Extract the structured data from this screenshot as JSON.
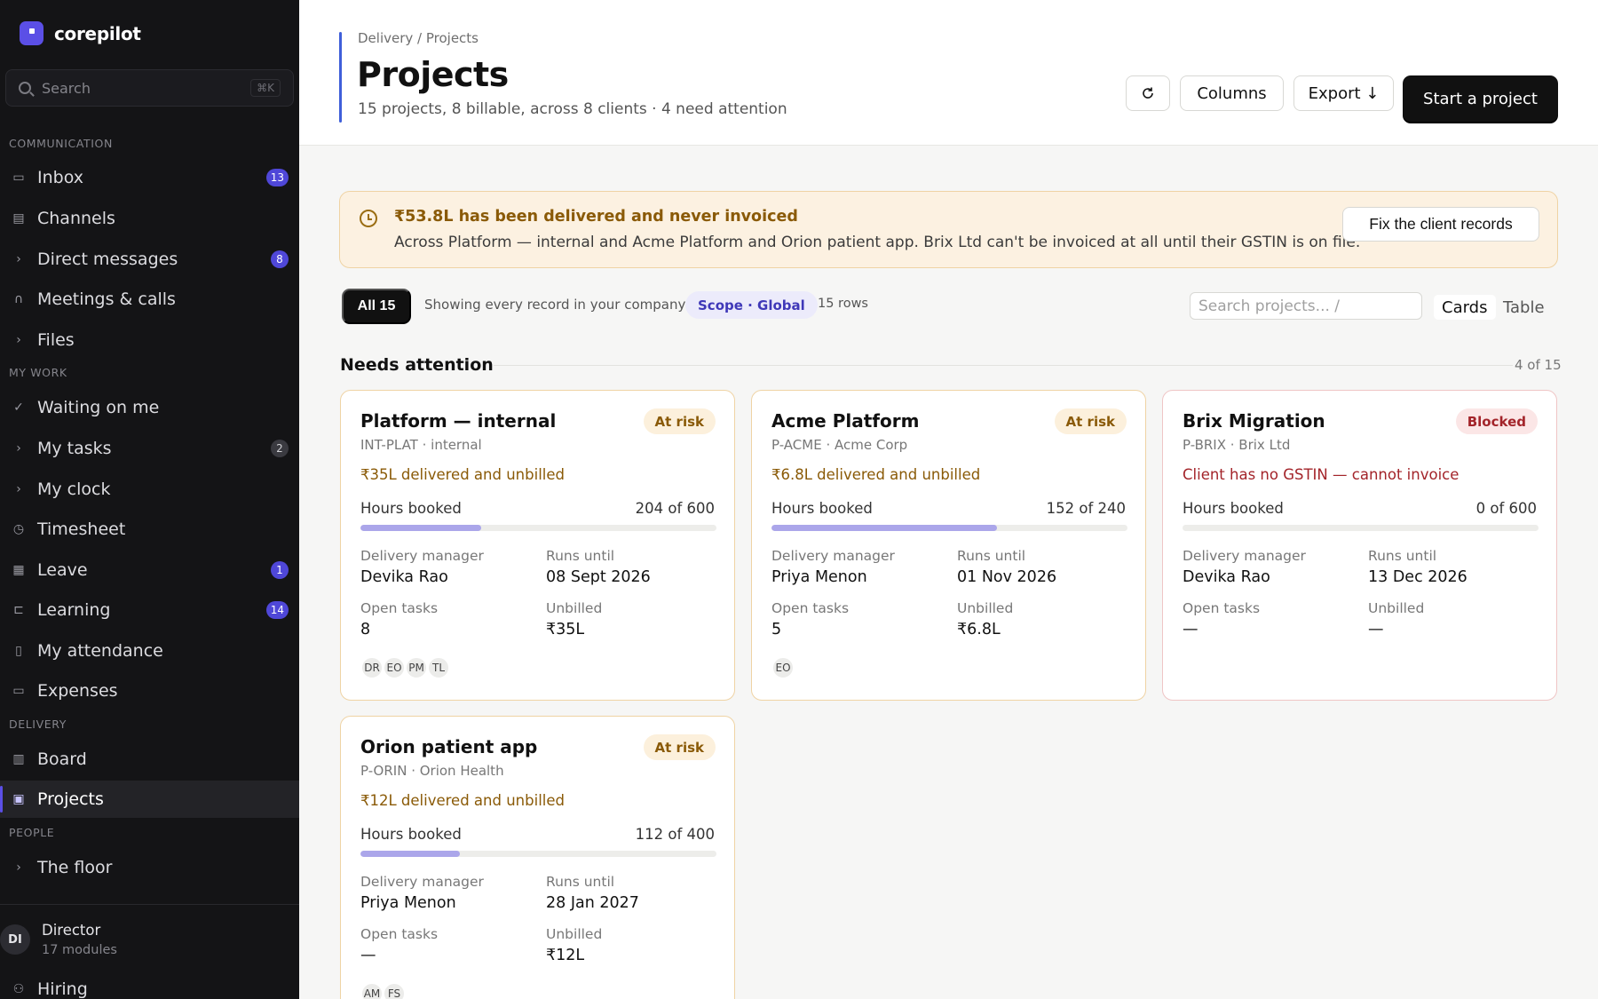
{
  "app": {
    "name": "corepilot"
  },
  "search": {
    "placeholder": "Search",
    "shortcut": "⌘K"
  },
  "sidebar": {
    "sections": {
      "communication": "COMMUNICATION",
      "my_work": "MY WORK",
      "delivery": "DELIVERY",
      "people": "PEOPLE"
    },
    "items": {
      "inbox": {
        "label": "Inbox",
        "badge": "13",
        "icon": "inbox-icon"
      },
      "channels": {
        "label": "Channels",
        "icon": "chat-icon"
      },
      "direct_messages": {
        "label": "Direct messages",
        "badge": "8",
        "icon": "chevron-right-icon"
      },
      "meetings": {
        "label": "Meetings & calls",
        "icon": "headset-icon"
      },
      "files": {
        "label": "Files",
        "icon": "chevron-right-icon"
      },
      "waiting": {
        "label": "Waiting on me",
        "icon": "check-icon"
      },
      "my_tasks": {
        "label": "My tasks",
        "badge": "2",
        "icon": "chevron-right-icon"
      },
      "my_clock": {
        "label": "My clock",
        "icon": "chevron-right-icon"
      },
      "timesheet": {
        "label": "Timesheet",
        "icon": "clock-icon"
      },
      "leave": {
        "label": "Leave",
        "badge": "1",
        "icon": "calendar-icon"
      },
      "learning": {
        "label": "Learning",
        "badge": "14",
        "icon": "easel-icon"
      },
      "attendance": {
        "label": "My attendance",
        "icon": "phone-icon"
      },
      "expenses": {
        "label": "Expenses",
        "icon": "card-icon"
      },
      "board": {
        "label": "Board",
        "icon": "kanban-icon"
      },
      "projects": {
        "label": "Projects",
        "icon": "briefcase-icon"
      },
      "the_floor": {
        "label": "The floor",
        "icon": "chevron-right-icon"
      },
      "hiring": {
        "label": "Hiring",
        "icon": "user-add-icon"
      }
    },
    "user": {
      "initials": "DI",
      "name": "Director",
      "subtitle": "17 modules"
    }
  },
  "header": {
    "breadcrumb": "Delivery / Projects",
    "title": "Projects",
    "subtitle": "15 projects, 8 billable, across 8 clients · 4 need attention",
    "refresh_icon": "refresh-icon",
    "columns_label": "Columns",
    "export_label": "Export ↓",
    "start_label": "Start a project"
  },
  "alert": {
    "icon": "clock-icon",
    "title": "₹53.8L has been delivered and never invoiced",
    "text": "Across Platform — internal and Acme Platform and Orion patient app. Brix Ltd can't be invoiced at all until their GSTIN is on file.",
    "button": "Fix the client records"
  },
  "filters": {
    "all_label": "All 15",
    "showing_text": "Showing every record in your company",
    "scope": "Scope · Global",
    "rows": "15 rows",
    "search_placeholder": "Search projects...  /",
    "view_cards": "Cards",
    "view_table": "Table"
  },
  "section": {
    "title": "Needs attention",
    "count": "4 of 15"
  },
  "labels": {
    "hours_booked": "Hours booked",
    "delivery_manager": "Delivery manager",
    "runs_until": "Runs until",
    "open_tasks": "Open tasks",
    "unbilled": "Unbilled"
  },
  "projects": [
    {
      "name": "Platform — internal",
      "status": "At risk",
      "code": "INT-PLAT · internal",
      "alert": "₹35L delivered and unbilled",
      "hours": "204 of 600",
      "hours_fraction": 0.34,
      "manager": "Devika Rao",
      "runs_until": "08 Sept 2026",
      "open_tasks": "8",
      "unbilled": "₹35L",
      "avatars": [
        "DR",
        "EO",
        "PM",
        "TL"
      ]
    },
    {
      "name": "Acme Platform",
      "status": "At risk",
      "code": "P-ACME · Acme Corp",
      "alert": "₹6.8L delivered and unbilled",
      "hours": "152 of 240",
      "hours_fraction": 0.633,
      "manager": "Priya Menon",
      "runs_until": "01 Nov 2026",
      "open_tasks": "5",
      "unbilled": "₹6.8L",
      "avatars": [
        "EO"
      ]
    },
    {
      "name": "Brix Migration",
      "status": "Blocked",
      "code": "P-BRIX · Brix Ltd",
      "alert": "Client has no GSTIN — cannot invoice",
      "hours": "0 of 600",
      "hours_fraction": 0,
      "manager": "Devika Rao",
      "runs_until": "13 Dec 2026",
      "open_tasks": "—",
      "unbilled": "—",
      "avatars": []
    },
    {
      "name": "Orion patient app",
      "status": "At risk",
      "code": "P-ORIN · Orion Health",
      "alert": "₹12L delivered and unbilled",
      "hours": "112 of 400",
      "hours_fraction": 0.28,
      "manager": "Priya Menon",
      "runs_until": "28 Jan 2027",
      "open_tasks": "—",
      "unbilled": "₹12L",
      "avatars": [
        "AM",
        "FS"
      ]
    }
  ]
}
